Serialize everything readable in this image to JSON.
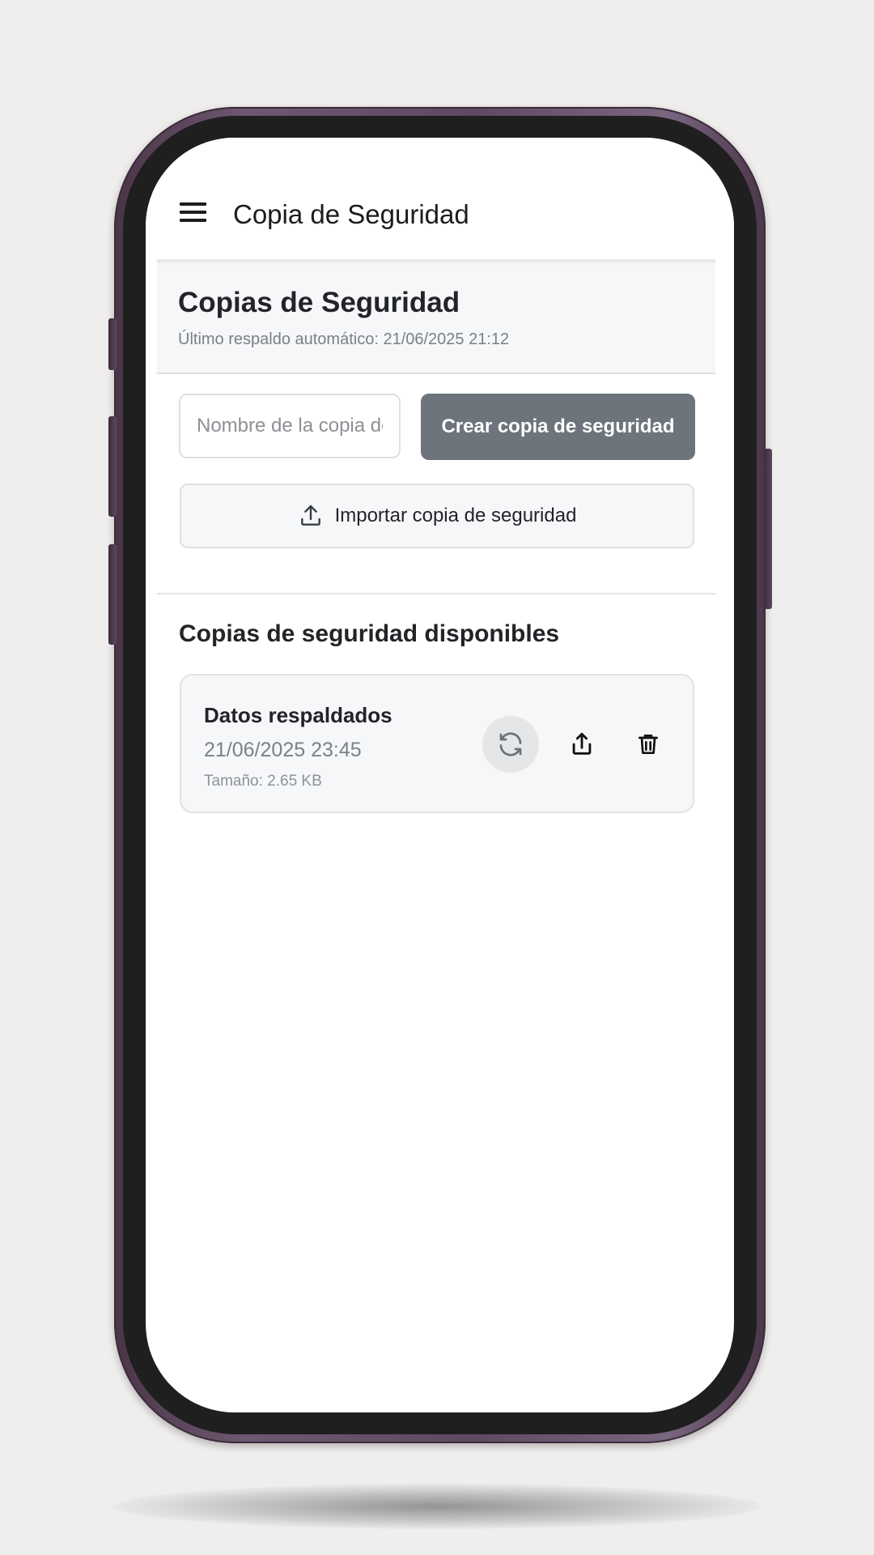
{
  "app_bar": {
    "title": "Copia de Seguridad",
    "menu_icon": "hamburger-menu-icon"
  },
  "header": {
    "title": "Copias de Seguridad",
    "last_backup": "Último respaldo automático: 21/06/2025 21:12"
  },
  "create": {
    "name_placeholder": "Nombre de la copia de seguridad",
    "name_value": "",
    "button_label": "Crear copia de seguridad"
  },
  "import": {
    "button_label": "Importar copia de seguridad",
    "icon": "upload-icon"
  },
  "backups": {
    "title": "Copias de seguridad disponibles",
    "items": [
      {
        "name": "Datos respaldados",
        "date": "21/06/2025 23:45",
        "size": "Tamaño: 2.65 KB",
        "actions": [
          "refresh-icon",
          "share-icon",
          "trash-icon"
        ]
      }
    ]
  },
  "colors": {
    "primary_button": "#6d747c",
    "section_background": "#f6f7f9",
    "phone_frame": "#5e4a60"
  }
}
